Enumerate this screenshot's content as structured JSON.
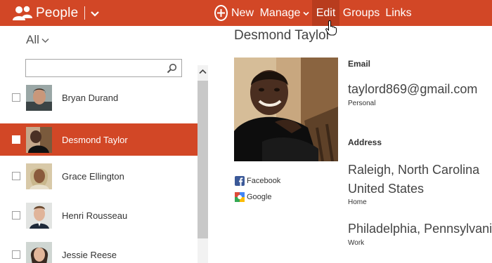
{
  "app": {
    "title": "People"
  },
  "nav": {
    "new_label": "New",
    "manage_label": "Manage",
    "edit_label": "Edit",
    "groups_label": "Groups",
    "links_label": "Links"
  },
  "filter": {
    "label": "All"
  },
  "search": {
    "placeholder": "",
    "value": ""
  },
  "contacts": [
    {
      "name": "Bryan Durand",
      "selected": false
    },
    {
      "name": "Desmond Taylor",
      "selected": true
    },
    {
      "name": "Grace Ellington",
      "selected": false
    },
    {
      "name": "Henri Rousseau",
      "selected": false
    },
    {
      "name": "Jessie Reese",
      "selected": false
    }
  ],
  "detail": {
    "name": "Desmond Taylor",
    "social": {
      "facebook_label": "Facebook",
      "google_label": "Google"
    },
    "email_heading": "Email",
    "email_value": "taylord869@gmail.com",
    "email_type": "Personal",
    "address_heading": "Address",
    "address1_line1": "Raleigh, North Carolina",
    "address1_line2": "United States",
    "address1_type": "Home",
    "address2_line1": "Philadelphia, Pennsylvania",
    "address2_type": "Work"
  },
  "colors": {
    "accent": "#d24726",
    "accent_active": "#b83c1e"
  }
}
